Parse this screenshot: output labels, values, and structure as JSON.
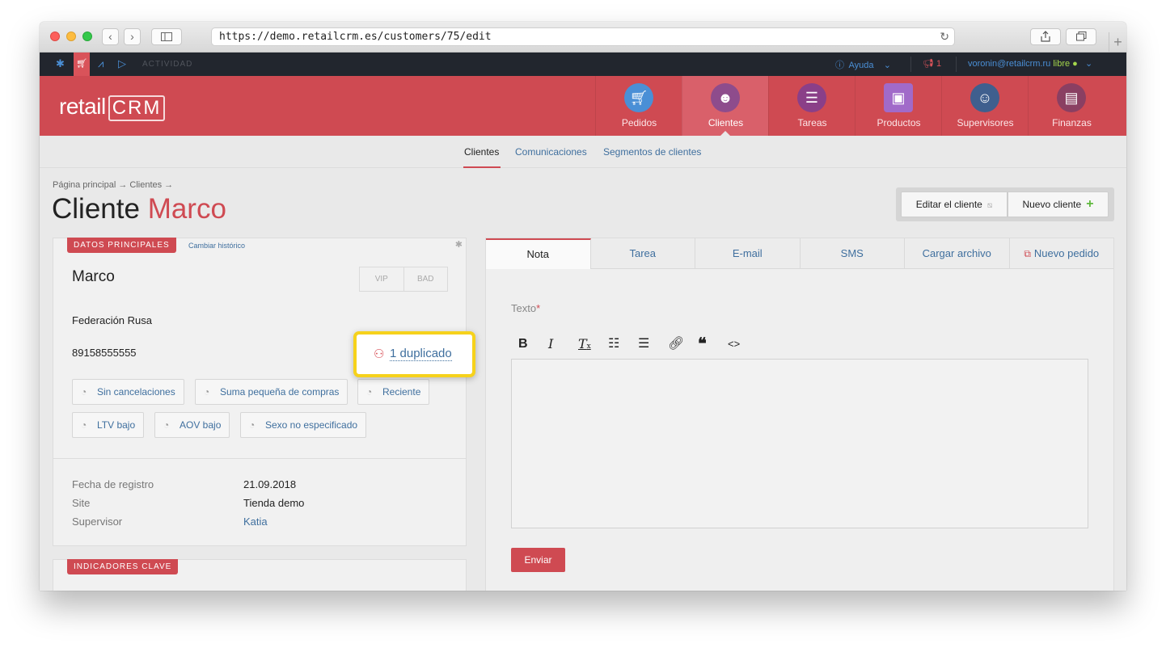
{
  "browser": {
    "url": "https://demo.retailcrm.es/customers/75/edit"
  },
  "topbar": {
    "activity": "ACTIVIDAD",
    "help": "Ayuda",
    "notifications": "1",
    "user_email": "voronin@retailcrm.ru",
    "status": "libre"
  },
  "header": {
    "logo": "retail",
    "logo_crm": "CRM",
    "nav": [
      {
        "label": "Pedidos",
        "icon": "cart-icon",
        "color": "#4a8fd6"
      },
      {
        "label": "Clientes",
        "icon": "person-icon",
        "color": "#8e4c8c"
      },
      {
        "label": "Tareas",
        "icon": "chat-list-icon",
        "color": "#8a3f88"
      },
      {
        "label": "Productos",
        "icon": "box-icon",
        "color": "#a16ac9"
      },
      {
        "label": "Supervisores",
        "icon": "woman-icon",
        "color": "#3f5f8e"
      },
      {
        "label": "Finanzas",
        "icon": "receipt-icon",
        "color": "#8a3f62"
      }
    ]
  },
  "subnav": {
    "items": [
      "Clientes",
      "Comunicaciones",
      "Segmentos de clientes"
    ]
  },
  "page": {
    "breadcrumb": "Página principal → Clientes →",
    "title_prefix": "Cliente",
    "title_name": "Marco",
    "edit_button": "Editar el cliente",
    "new_button": "Nuevo cliente"
  },
  "card": {
    "tag": "DATOS PRINCIPALES",
    "history_link": "Cambiar histórico",
    "name": "Marco",
    "vip": "VIP",
    "bad": "BAD",
    "country": "Federación Rusa",
    "phone": "89158555555",
    "segments": [
      "Sin cancelaciones",
      "Suma pequeña de compras",
      "Reciente",
      "LTV bajo",
      "AOV bajo",
      "Sexo no especificado"
    ],
    "info": [
      {
        "label": "Fecha de registro",
        "value": "21.09.2018"
      },
      {
        "label": "Site",
        "value": "Tienda demo"
      },
      {
        "label": "Supervisor",
        "value": "Katia"
      }
    ],
    "duplicate": "1 duplicado"
  },
  "card2": {
    "tag": "INDICADORES CLAVE"
  },
  "panel": {
    "tabs": [
      "Nota",
      "Tarea",
      "E-mail",
      "SMS",
      "Cargar archivo",
      "Nuevo pedido"
    ],
    "text_label": "Texto",
    "required_mark": "*",
    "editor_tools": [
      "B",
      "I",
      "Tx",
      "bulleted-list",
      "numbered-list",
      "link",
      "quote",
      "code"
    ],
    "send": "Enviar"
  },
  "colors": {
    "brand_red": "#cf4a52",
    "link_blue": "#3f6f9e",
    "highlight_yellow": "#f6d21c"
  }
}
